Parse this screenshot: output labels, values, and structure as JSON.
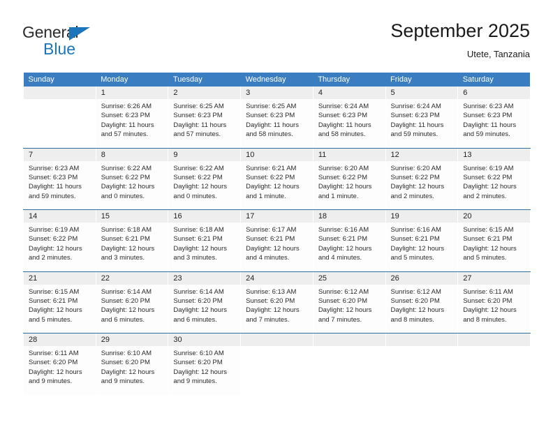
{
  "brand": {
    "name_part1": "General",
    "name_part2": "Blue",
    "logo_icon": "triangle-flag-icon"
  },
  "header": {
    "title": "September 2025",
    "subtitle": "Utete, Tanzania"
  },
  "theme": {
    "header_blue": "#3a7dc0",
    "rule_blue": "#2e6da4",
    "daynum_gray": "#eeeeee",
    "brand_blue": "#1b75bb"
  },
  "weekdays": [
    "Sunday",
    "Monday",
    "Tuesday",
    "Wednesday",
    "Thursday",
    "Friday",
    "Saturday"
  ],
  "weeks": [
    [
      {
        "day": "",
        "l1": "",
        "l2": "",
        "l3": "",
        "l4": "",
        "empty": true
      },
      {
        "day": "1",
        "l1": "Sunrise: 6:26 AM",
        "l2": "Sunset: 6:23 PM",
        "l3": "Daylight: 11 hours",
        "l4": "and 57 minutes."
      },
      {
        "day": "2",
        "l1": "Sunrise: 6:25 AM",
        "l2": "Sunset: 6:23 PM",
        "l3": "Daylight: 11 hours",
        "l4": "and 57 minutes."
      },
      {
        "day": "3",
        "l1": "Sunrise: 6:25 AM",
        "l2": "Sunset: 6:23 PM",
        "l3": "Daylight: 11 hours",
        "l4": "and 58 minutes."
      },
      {
        "day": "4",
        "l1": "Sunrise: 6:24 AM",
        "l2": "Sunset: 6:23 PM",
        "l3": "Daylight: 11 hours",
        "l4": "and 58 minutes."
      },
      {
        "day": "5",
        "l1": "Sunrise: 6:24 AM",
        "l2": "Sunset: 6:23 PM",
        "l3": "Daylight: 11 hours",
        "l4": "and 59 minutes."
      },
      {
        "day": "6",
        "l1": "Sunrise: 6:23 AM",
        "l2": "Sunset: 6:23 PM",
        "l3": "Daylight: 11 hours",
        "l4": "and 59 minutes."
      }
    ],
    [
      {
        "day": "7",
        "l1": "Sunrise: 6:23 AM",
        "l2": "Sunset: 6:23 PM",
        "l3": "Daylight: 11 hours",
        "l4": "and 59 minutes."
      },
      {
        "day": "8",
        "l1": "Sunrise: 6:22 AM",
        "l2": "Sunset: 6:22 PM",
        "l3": "Daylight: 12 hours",
        "l4": "and 0 minutes."
      },
      {
        "day": "9",
        "l1": "Sunrise: 6:22 AM",
        "l2": "Sunset: 6:22 PM",
        "l3": "Daylight: 12 hours",
        "l4": "and 0 minutes."
      },
      {
        "day": "10",
        "l1": "Sunrise: 6:21 AM",
        "l2": "Sunset: 6:22 PM",
        "l3": "Daylight: 12 hours",
        "l4": "and 1 minute."
      },
      {
        "day": "11",
        "l1": "Sunrise: 6:20 AM",
        "l2": "Sunset: 6:22 PM",
        "l3": "Daylight: 12 hours",
        "l4": "and 1 minute."
      },
      {
        "day": "12",
        "l1": "Sunrise: 6:20 AM",
        "l2": "Sunset: 6:22 PM",
        "l3": "Daylight: 12 hours",
        "l4": "and 2 minutes."
      },
      {
        "day": "13",
        "l1": "Sunrise: 6:19 AM",
        "l2": "Sunset: 6:22 PM",
        "l3": "Daylight: 12 hours",
        "l4": "and 2 minutes."
      }
    ],
    [
      {
        "day": "14",
        "l1": "Sunrise: 6:19 AM",
        "l2": "Sunset: 6:22 PM",
        "l3": "Daylight: 12 hours",
        "l4": "and 2 minutes."
      },
      {
        "day": "15",
        "l1": "Sunrise: 6:18 AM",
        "l2": "Sunset: 6:21 PM",
        "l3": "Daylight: 12 hours",
        "l4": "and 3 minutes."
      },
      {
        "day": "16",
        "l1": "Sunrise: 6:18 AM",
        "l2": "Sunset: 6:21 PM",
        "l3": "Daylight: 12 hours",
        "l4": "and 3 minutes."
      },
      {
        "day": "17",
        "l1": "Sunrise: 6:17 AM",
        "l2": "Sunset: 6:21 PM",
        "l3": "Daylight: 12 hours",
        "l4": "and 4 minutes."
      },
      {
        "day": "18",
        "l1": "Sunrise: 6:16 AM",
        "l2": "Sunset: 6:21 PM",
        "l3": "Daylight: 12 hours",
        "l4": "and 4 minutes."
      },
      {
        "day": "19",
        "l1": "Sunrise: 6:16 AM",
        "l2": "Sunset: 6:21 PM",
        "l3": "Daylight: 12 hours",
        "l4": "and 5 minutes."
      },
      {
        "day": "20",
        "l1": "Sunrise: 6:15 AM",
        "l2": "Sunset: 6:21 PM",
        "l3": "Daylight: 12 hours",
        "l4": "and 5 minutes."
      }
    ],
    [
      {
        "day": "21",
        "l1": "Sunrise: 6:15 AM",
        "l2": "Sunset: 6:21 PM",
        "l3": "Daylight: 12 hours",
        "l4": "and 5 minutes."
      },
      {
        "day": "22",
        "l1": "Sunrise: 6:14 AM",
        "l2": "Sunset: 6:20 PM",
        "l3": "Daylight: 12 hours",
        "l4": "and 6 minutes."
      },
      {
        "day": "23",
        "l1": "Sunrise: 6:14 AM",
        "l2": "Sunset: 6:20 PM",
        "l3": "Daylight: 12 hours",
        "l4": "and 6 minutes."
      },
      {
        "day": "24",
        "l1": "Sunrise: 6:13 AM",
        "l2": "Sunset: 6:20 PM",
        "l3": "Daylight: 12 hours",
        "l4": "and 7 minutes."
      },
      {
        "day": "25",
        "l1": "Sunrise: 6:12 AM",
        "l2": "Sunset: 6:20 PM",
        "l3": "Daylight: 12 hours",
        "l4": "and 7 minutes."
      },
      {
        "day": "26",
        "l1": "Sunrise: 6:12 AM",
        "l2": "Sunset: 6:20 PM",
        "l3": "Daylight: 12 hours",
        "l4": "and 8 minutes."
      },
      {
        "day": "27",
        "l1": "Sunrise: 6:11 AM",
        "l2": "Sunset: 6:20 PM",
        "l3": "Daylight: 12 hours",
        "l4": "and 8 minutes."
      }
    ],
    [
      {
        "day": "28",
        "l1": "Sunrise: 6:11 AM",
        "l2": "Sunset: 6:20 PM",
        "l3": "Daylight: 12 hours",
        "l4": "and 9 minutes."
      },
      {
        "day": "29",
        "l1": "Sunrise: 6:10 AM",
        "l2": "Sunset: 6:20 PM",
        "l3": "Daylight: 12 hours",
        "l4": "and 9 minutes."
      },
      {
        "day": "30",
        "l1": "Sunrise: 6:10 AM",
        "l2": "Sunset: 6:20 PM",
        "l3": "Daylight: 12 hours",
        "l4": "and 9 minutes."
      },
      {
        "day": "",
        "l1": "",
        "l2": "",
        "l3": "",
        "l4": "",
        "empty": true
      },
      {
        "day": "",
        "l1": "",
        "l2": "",
        "l3": "",
        "l4": "",
        "empty": true
      },
      {
        "day": "",
        "l1": "",
        "l2": "",
        "l3": "",
        "l4": "",
        "empty": true
      },
      {
        "day": "",
        "l1": "",
        "l2": "",
        "l3": "",
        "l4": "",
        "empty": true
      }
    ]
  ]
}
